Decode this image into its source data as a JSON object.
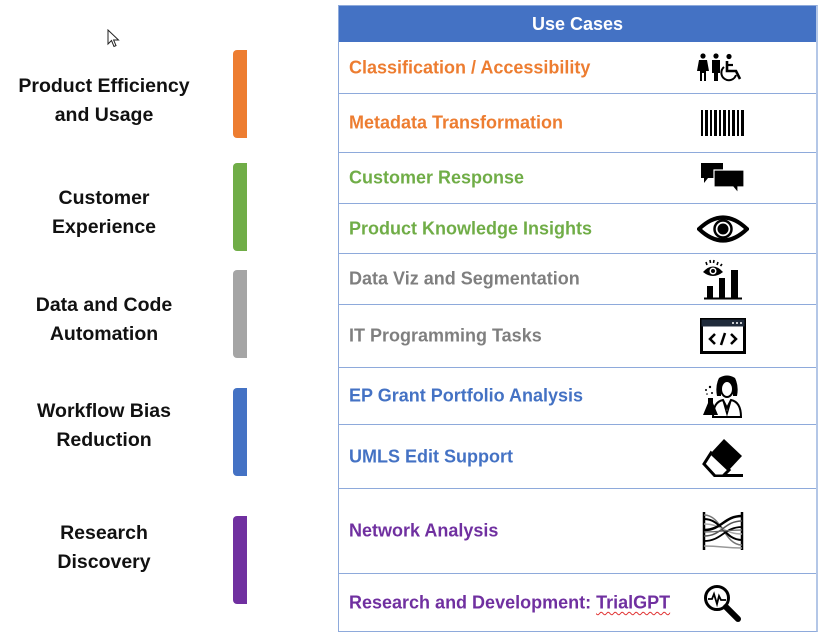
{
  "table": {
    "header": "Use Cases"
  },
  "colors": {
    "orange": "#ed7d31",
    "green": "#70ad47",
    "gray": "#a5a5a5",
    "blue": "#4472c4",
    "purple": "#7030a0",
    "header_bg": "#4472c4",
    "border": "#8eaadb"
  },
  "categories": [
    {
      "line1": "Product Efficiency",
      "line2": "and Usage",
      "color": "#ed7d31"
    },
    {
      "line1": "Customer",
      "line2": "Experience",
      "color": "#70ad47"
    },
    {
      "line1": "Data and Code",
      "line2": "Automation",
      "color": "#a5a5a5"
    },
    {
      "line1": "Workflow Bias",
      "line2": "Reduction",
      "color": "#4472c4"
    },
    {
      "line1": "Research",
      "line2": "Discovery",
      "color": "#7030a0"
    }
  ],
  "use_cases": [
    {
      "label": "Classification / Accessibility",
      "icon": "people-accessibility-icon",
      "color": "#ed7d31"
    },
    {
      "label": "Metadata Transformation",
      "icon": "barcode-icon",
      "color": "#ed7d31"
    },
    {
      "label": "Customer Response",
      "icon": "chat-bubbles-icon",
      "color": "#70ad47"
    },
    {
      "label": "Product Knowledge Insights",
      "icon": "eye-icon",
      "color": "#70ad47"
    },
    {
      "label": "Data Viz and Segmentation",
      "icon": "eye-bar-chart-icon",
      "color": "#7f7f7f"
    },
    {
      "label": "IT Programming Tasks",
      "icon": "code-window-icon",
      "color": "#7f7f7f"
    },
    {
      "label": "EP Grant Portfolio Analysis",
      "icon": "scientist-icon",
      "color": "#4472c4"
    },
    {
      "label": "UMLS Edit Support",
      "icon": "eraser-icon",
      "color": "#4472c4"
    },
    {
      "label": "Network Analysis",
      "icon": "network-flow-icon",
      "color": "#7030a0"
    },
    {
      "label_prefix": "Research and Development: ",
      "label_suffix": "TrialGPT",
      "icon": "search-pulse-icon",
      "color": "#7030a0"
    }
  ]
}
